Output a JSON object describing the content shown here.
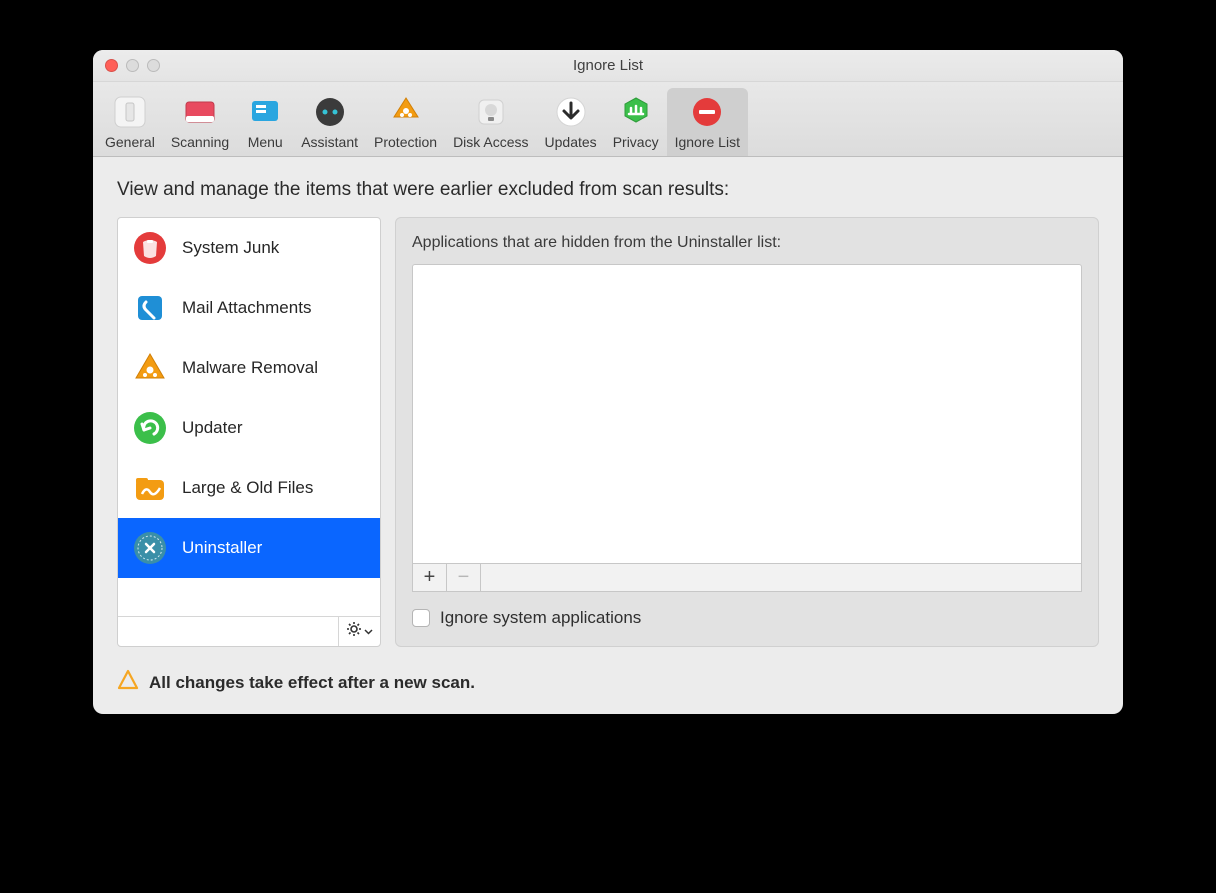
{
  "window": {
    "title": "Ignore List"
  },
  "toolbar": {
    "items": [
      {
        "label": "General"
      },
      {
        "label": "Scanning"
      },
      {
        "label": "Menu"
      },
      {
        "label": "Assistant"
      },
      {
        "label": "Protection"
      },
      {
        "label": "Disk Access"
      },
      {
        "label": "Updates"
      },
      {
        "label": "Privacy"
      },
      {
        "label": "Ignore List"
      }
    ],
    "selected_index": 8
  },
  "heading": "View and manage the items that were earlier excluded from scan results:",
  "sidebar": {
    "items": [
      {
        "label": "System Junk"
      },
      {
        "label": "Mail Attachments"
      },
      {
        "label": "Malware Removal"
      },
      {
        "label": "Updater"
      },
      {
        "label": "Large & Old Files"
      },
      {
        "label": "Uninstaller"
      }
    ],
    "selected_index": 5
  },
  "panel": {
    "subheading": "Applications that are hidden from the Uninstaller list:",
    "add_label": "+",
    "remove_label": "−",
    "checkbox_label": "Ignore system applications",
    "checkbox_checked": false
  },
  "footer": {
    "note": "All changes take effect after a new scan."
  }
}
